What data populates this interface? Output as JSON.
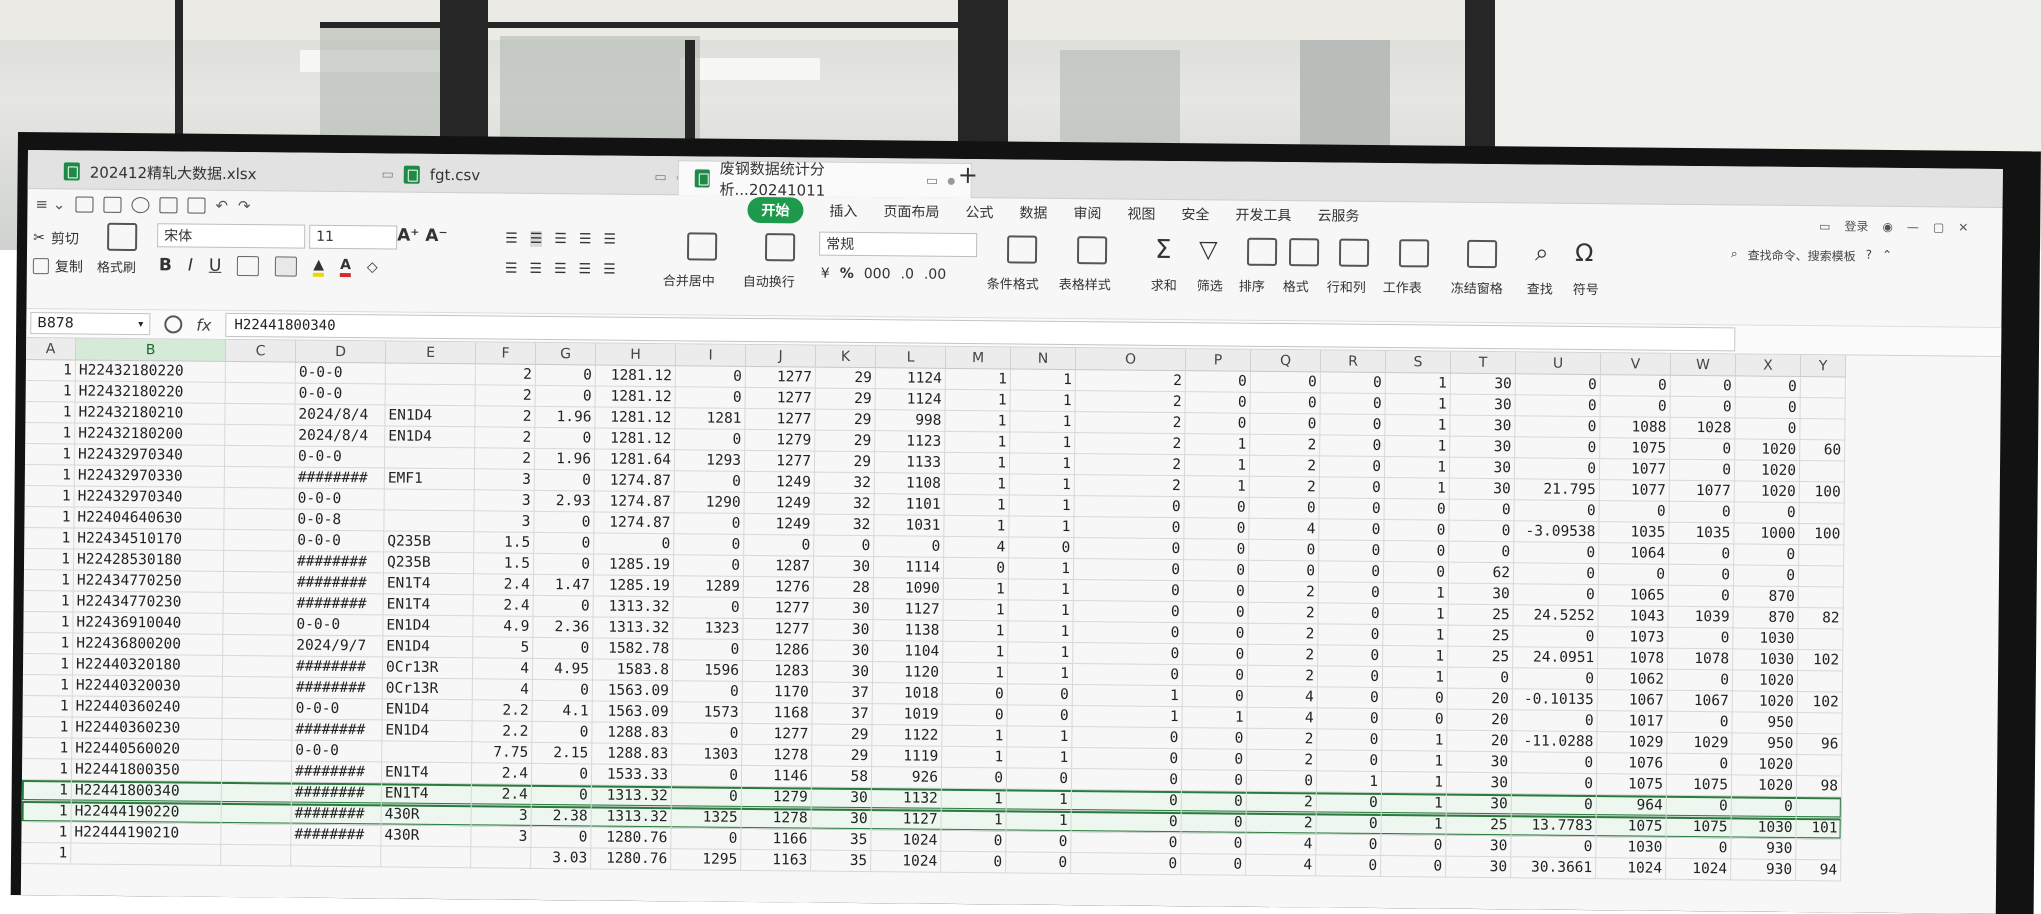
{
  "tabs": [
    {
      "label": "202412精轧大数据.xlsx",
      "active": false
    },
    {
      "label": "fgt.csv",
      "active": false
    },
    {
      "label": "废钢数据统计分析...20241011",
      "active": true
    }
  ],
  "new_tab_label": "+",
  "menu_tabs": [
    "开始",
    "插入",
    "页面布局",
    "公式",
    "数据",
    "审阅",
    "视图",
    "安全",
    "开发工具",
    "云服务"
  ],
  "login_label": "登录",
  "ribbon": {
    "cut": "剪切",
    "copy": "复制",
    "format_painter": "格式刷",
    "font_name": "宋体",
    "font_size": "11",
    "merge_center": "合并居中",
    "wrap_text": "自动换行",
    "number_format": "常规",
    "conditional_format": "条件格式",
    "table_style": "表格样式",
    "sum": "求和",
    "filter": "筛选",
    "sort": "排序",
    "format": "格式",
    "row_col": "行和列",
    "worksheet": "工作表",
    "freeze": "冻结窗格",
    "find": "查找",
    "symbol": "符号",
    "search_cmd": "查找命令、搜索模板"
  },
  "formula_bar": {
    "name_box": "B878",
    "fx_label": "fx",
    "value": "H22441800340"
  },
  "columns": [
    "A",
    "B",
    "C",
    "D",
    "E",
    "F",
    "G",
    "H",
    "I",
    "J",
    "K",
    "L",
    "M",
    "N",
    "O",
    "P",
    "Q",
    "R",
    "S",
    "T",
    "U",
    "V",
    "W",
    "X",
    "Y"
  ],
  "selected_column": "B",
  "rows": [
    [
      "1",
      "H22432180220",
      "",
      "0-0-0",
      "",
      "2",
      "0",
      "1281.12",
      "0",
      "1277",
      "29",
      "1124",
      "1",
      "1",
      "2",
      "0",
      "0",
      "0",
      "1",
      "30",
      "0",
      "0",
      "0",
      "0",
      ""
    ],
    [
      "1",
      "H22432180220",
      "",
      "0-0-0",
      "",
      "2",
      "0",
      "1281.12",
      "0",
      "1277",
      "29",
      "1124",
      "1",
      "1",
      "2",
      "0",
      "0",
      "0",
      "1",
      "30",
      "0",
      "0",
      "0",
      "0",
      ""
    ],
    [
      "1",
      "H22432180210",
      "",
      "2024/8/4",
      "EN1D4",
      "2",
      "1.96",
      "1281.12",
      "1281",
      "1277",
      "29",
      "998",
      "1",
      "1",
      "2",
      "0",
      "0",
      "0",
      "1",
      "30",
      "0",
      "1088",
      "1028",
      "0",
      ""
    ],
    [
      "1",
      "H22432180200",
      "",
      "2024/8/4",
      "EN1D4",
      "2",
      "0",
      "1281.12",
      "0",
      "1279",
      "29",
      "1123",
      "1",
      "1",
      "2",
      "1",
      "2",
      "0",
      "1",
      "30",
      "0",
      "1075",
      "0",
      "1020",
      "60"
    ],
    [
      "1",
      "H22432970340",
      "",
      "0-0-0",
      "",
      "2",
      "1.96",
      "1281.64",
      "1293",
      "1277",
      "29",
      "1133",
      "1",
      "1",
      "2",
      "1",
      "2",
      "0",
      "1",
      "30",
      "0",
      "1077",
      "0",
      "1020",
      ""
    ],
    [
      "1",
      "H22432970330",
      "",
      "########",
      "EMF1",
      "3",
      "0",
      "1274.87",
      "0",
      "1249",
      "32",
      "1108",
      "1",
      "1",
      "2",
      "1",
      "2",
      "0",
      "1",
      "30",
      "21.795",
      "1077",
      "1077",
      "1020",
      "100"
    ],
    [
      "1",
      "H22432970340",
      "",
      "0-0-0",
      "",
      "3",
      "2.93",
      "1274.87",
      "1290",
      "1249",
      "32",
      "1101",
      "1",
      "1",
      "0",
      "0",
      "0",
      "0",
      "0",
      "0",
      "0",
      "0",
      "0",
      "0",
      ""
    ],
    [
      "1",
      "H22404640630",
      "",
      "0-0-8",
      "",
      "3",
      "0",
      "1274.87",
      "0",
      "1249",
      "32",
      "1031",
      "1",
      "1",
      "0",
      "0",
      "4",
      "0",
      "0",
      "0",
      "-3.09538",
      "1035",
      "1035",
      "1000",
      "100"
    ],
    [
      "1",
      "H22434510170",
      "",
      "0-0-0",
      "Q235B",
      "1.5",
      "0",
      "0",
      "0",
      "0",
      "0",
      "0",
      "4",
      "0",
      "0",
      "0",
      "0",
      "0",
      "0",
      "0",
      "0",
      "1064",
      "0",
      "0",
      ""
    ],
    [
      "1",
      "H22428530180",
      "",
      "########",
      "Q235B",
      "1.5",
      "0",
      "1285.19",
      "0",
      "1287",
      "30",
      "1114",
      "0",
      "1",
      "0",
      "0",
      "0",
      "0",
      "0",
      "62",
      "0",
      "0",
      "0",
      "0",
      ""
    ],
    [
      "1",
      "H22434770250",
      "",
      "########",
      "EN1T4",
      "2.4",
      "1.47",
      "1285.19",
      "1289",
      "1276",
      "28",
      "1090",
      "1",
      "1",
      "0",
      "0",
      "2",
      "0",
      "1",
      "30",
      "0",
      "1065",
      "0",
      "870",
      ""
    ],
    [
      "1",
      "H22434770230",
      "",
      "########",
      "EN1T4",
      "2.4",
      "0",
      "1313.32",
      "0",
      "1277",
      "30",
      "1127",
      "1",
      "1",
      "0",
      "0",
      "2",
      "0",
      "1",
      "25",
      "24.5252",
      "1043",
      "1039",
      "870",
      "82"
    ],
    [
      "1",
      "H22436910040",
      "",
      "0-0-0",
      "EN1D4",
      "4.9",
      "2.36",
      "1313.32",
      "1323",
      "1277",
      "30",
      "1138",
      "1",
      "1",
      "0",
      "0",
      "2",
      "0",
      "1",
      "25",
      "0",
      "1073",
      "0",
      "1030",
      ""
    ],
    [
      "1",
      "H22436800200",
      "",
      "2024/9/7",
      "EN1D4",
      "5",
      "0",
      "1582.78",
      "0",
      "1286",
      "30",
      "1104",
      "1",
      "1",
      "0",
      "0",
      "2",
      "0",
      "1",
      "25",
      "24.0951",
      "1078",
      "1078",
      "1030",
      "102"
    ],
    [
      "1",
      "H22440320180",
      "",
      "########",
      "0Cr13R",
      "4",
      "4.95",
      "1583.8",
      "1596",
      "1283",
      "30",
      "1120",
      "1",
      "1",
      "0",
      "0",
      "2",
      "0",
      "1",
      "0",
      "0",
      "1062",
      "0",
      "1020",
      ""
    ],
    [
      "1",
      "H22440320030",
      "",
      "########",
      "0Cr13R",
      "4",
      "0",
      "1563.09",
      "0",
      "1170",
      "37",
      "1018",
      "0",
      "0",
      "1",
      "0",
      "4",
      "0",
      "0",
      "20",
      "-0.10135",
      "1067",
      "1067",
      "1020",
      "102"
    ],
    [
      "1",
      "H22440360240",
      "",
      "0-0-0",
      "EN1D4",
      "2.2",
      "4.1",
      "1563.09",
      "1573",
      "1168",
      "37",
      "1019",
      "0",
      "0",
      "1",
      "1",
      "4",
      "0",
      "0",
      "20",
      "0",
      "1017",
      "0",
      "950",
      ""
    ],
    [
      "1",
      "H22440360230",
      "",
      "########",
      "EN1D4",
      "2.2",
      "0",
      "1288.83",
      "0",
      "1277",
      "29",
      "1122",
      "1",
      "1",
      "0",
      "0",
      "2",
      "0",
      "1",
      "20",
      "-11.0288",
      "1029",
      "1029",
      "950",
      "96"
    ],
    [
      "1",
      "H22440560020",
      "",
      "0-0-0",
      "",
      "7.75",
      "2.15",
      "1288.83",
      "1303",
      "1278",
      "29",
      "1119",
      "1",
      "1",
      "0",
      "0",
      "2",
      "0",
      "1",
      "30",
      "0",
      "1076",
      "0",
      "1020",
      ""
    ],
    [
      "1",
      "H22441800350",
      "",
      "########",
      "EN1T4",
      "2.4",
      "0",
      "1533.33",
      "0",
      "1146",
      "58",
      "926",
      "0",
      "0",
      "0",
      "0",
      "0",
      "1",
      "1",
      "30",
      "0",
      "1075",
      "1075",
      "1020",
      "98"
    ],
    [
      "1",
      "H22441800340",
      "",
      "########",
      "EN1T4",
      "2.4",
      "0",
      "1313.32",
      "0",
      "1279",
      "30",
      "1132",
      "1",
      "1",
      "0",
      "0",
      "2",
      "0",
      "1",
      "30",
      "0",
      "964",
      "0",
      "0",
      ""
    ],
    [
      "1",
      "H22444190220",
      "",
      "########",
      "430R",
      "3",
      "2.38",
      "1313.32",
      "1325",
      "1278",
      "30",
      "1127",
      "1",
      "1",
      "0",
      "0",
      "2",
      "0",
      "1",
      "25",
      "13.7783",
      "1075",
      "1075",
      "1030",
      "101"
    ],
    [
      "1",
      "H22444190210",
      "",
      "########",
      "430R",
      "3",
      "0",
      "1280.76",
      "0",
      "1166",
      "35",
      "1024",
      "0",
      "0",
      "0",
      "0",
      "4",
      "0",
      "0",
      "30",
      "0",
      "1030",
      "0",
      "930",
      ""
    ],
    [
      "1",
      "",
      "",
      "",
      "",
      "",
      "3.03",
      "1280.76",
      "1295",
      "1163",
      "35",
      "1024",
      "0",
      "0",
      "0",
      "0",
      "4",
      "0",
      "0",
      "30",
      "30.3661",
      "1024",
      "1024",
      "930",
      "94"
    ]
  ],
  "selected_rows": [
    20,
    21
  ]
}
